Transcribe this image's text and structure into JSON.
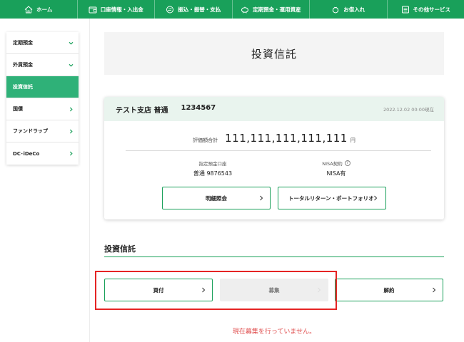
{
  "topnav": {
    "items": [
      {
        "label": "ホーム",
        "icon": "home-icon"
      },
      {
        "label": "口座情報・入出金",
        "icon": "wallet-icon"
      },
      {
        "label": "振込・振替・支払",
        "icon": "transfer-icon"
      },
      {
        "label": "定期預金・運用資産",
        "icon": "piggy-bank-icon"
      },
      {
        "label": "お借入れ",
        "icon": "loan-icon"
      },
      {
        "label": "その他サービス",
        "icon": "list-icon"
      }
    ]
  },
  "sidebar": {
    "items": [
      {
        "label": "定期預金",
        "chevron": "down",
        "active": false
      },
      {
        "label": "外貨預金",
        "chevron": "down",
        "active": false
      },
      {
        "label": "投資信託",
        "chevron": "none",
        "active": true
      },
      {
        "label": "国債",
        "chevron": "right",
        "active": false
      },
      {
        "label": "ファンドラップ",
        "chevron": "right",
        "active": false
      },
      {
        "label": "DC･iDeCo",
        "chevron": "right",
        "active": false
      }
    ]
  },
  "page": {
    "title": "投資信託"
  },
  "account_card": {
    "branch": "テスト支店 普通",
    "account_number": "1234567",
    "as_of": "2022.12.02 00:00現在",
    "valuation_label": "評価額合計",
    "valuation_value": "111,111,111,111,111",
    "valuation_unit": "円",
    "designated_label": "指定預金口座",
    "designated_value": "普通 9876543",
    "nisa_label": "NISA契約",
    "nisa_value": "NISA有",
    "detail_button": "明細照会",
    "portfolio_button": "トータルリターン・ポートフォリオ"
  },
  "section": {
    "title": "投資信託",
    "buy_button": "買付",
    "subscribe_button": "募集",
    "cancel_button": "解約",
    "notice": "現在募集を行っていません。"
  },
  "colors": {
    "brand_green": "#19a05a",
    "active_green": "#2fb178",
    "header_tint": "#e9f4ee",
    "highlight_red": "#e52424",
    "notice_red": "#e05050"
  }
}
